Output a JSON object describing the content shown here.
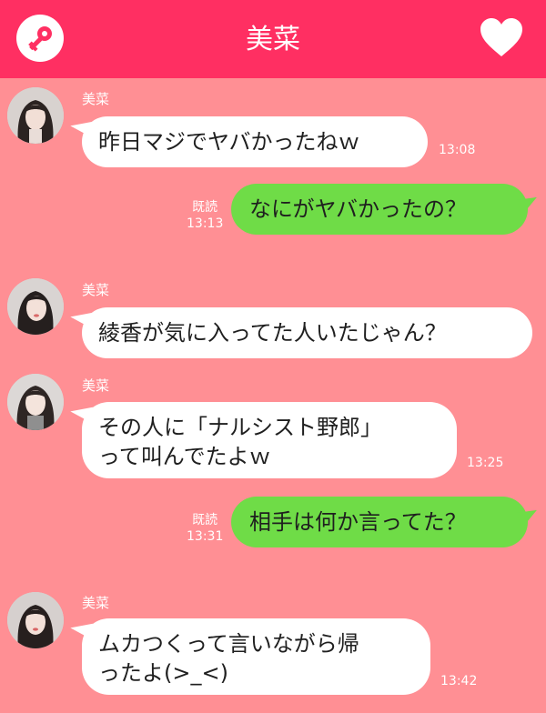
{
  "header": {
    "title": "美菜",
    "left_icon": "key-icon",
    "right_icon": "heart-icon",
    "color": "#ff2f62"
  },
  "theme": {
    "background": "#ff8f94",
    "incoming_bubble": "#ffffff",
    "outgoing_bubble": "#6fdc47"
  },
  "messages": [
    {
      "sender": "美菜",
      "text": "昨日マジでヤバかったねｗ",
      "time": "13:08"
    },
    {
      "read": "既読",
      "text": "なにがヤバかったの？",
      "time": "13:13"
    },
    {
      "sender": "美菜",
      "text": "綾香が気に入ってた人いたじゃん？",
      "time": ""
    },
    {
      "sender": "美菜",
      "text": "その人に「ナルシスト野郎」\nって叫んでたよｗ",
      "time": "13:25"
    },
    {
      "read": "既読",
      "text": "相手は何か言ってた？",
      "time": "13:31"
    },
    {
      "sender": "美菜",
      "text": "ムカつくって言いながら帰\nったよ(>_<)",
      "time": "13:42"
    }
  ]
}
